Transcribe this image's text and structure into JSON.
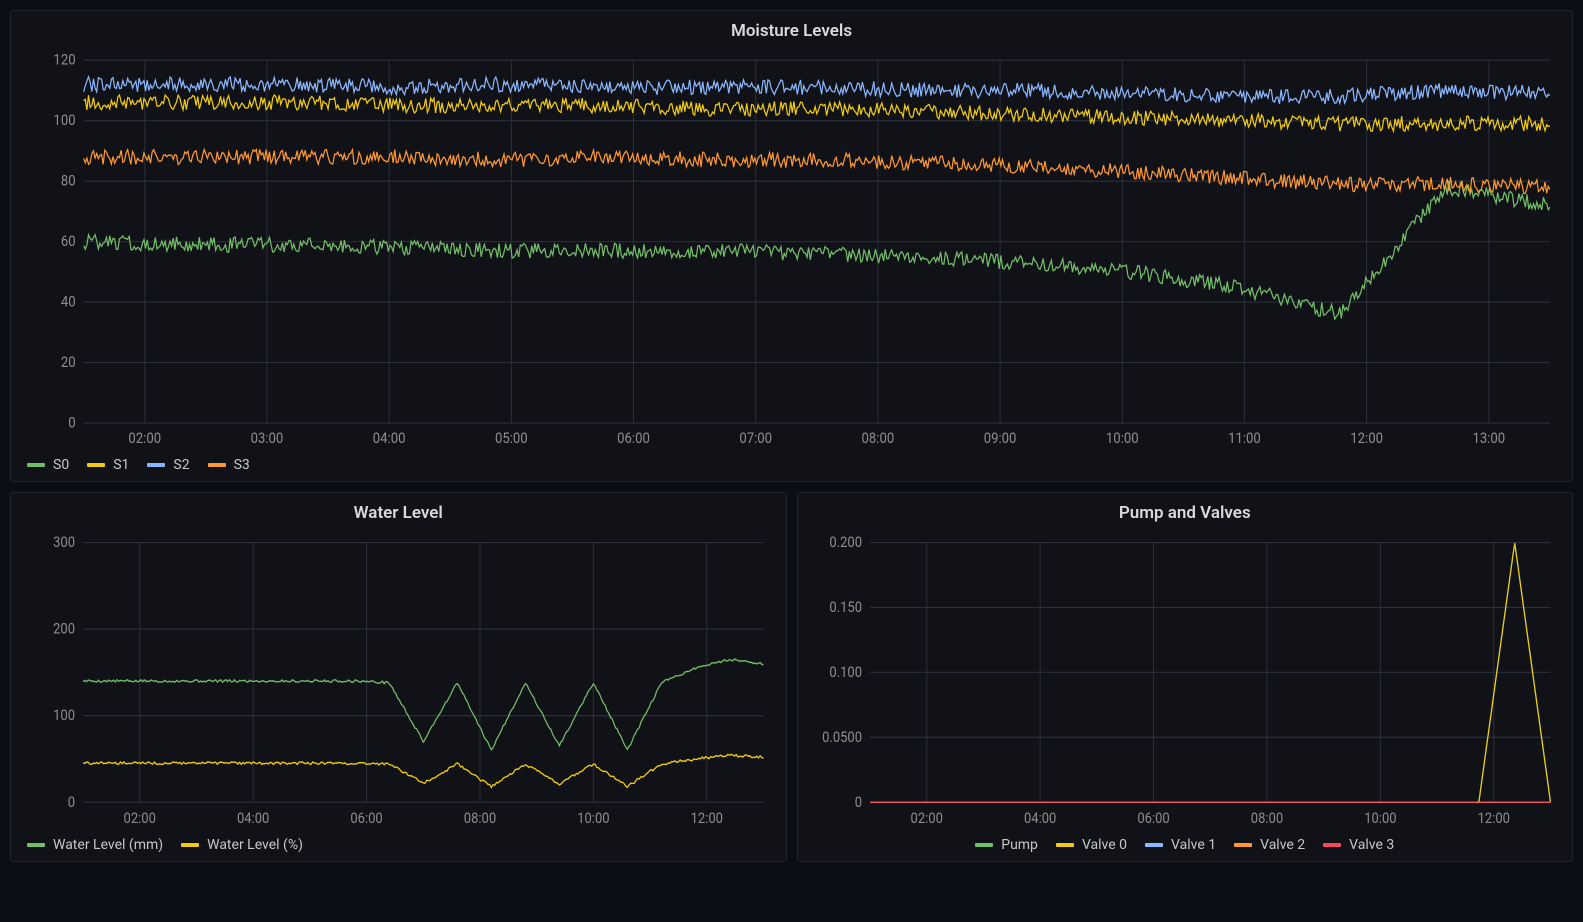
{
  "colors": {
    "green": "#73bf69",
    "yellow": "#f2cc0c",
    "blue": "#8ab8ff",
    "orange": "#ff9830",
    "red": "#f2495c"
  },
  "chart_data": [
    {
      "id": "moisture",
      "type": "line",
      "title": "Moisture Levels",
      "xlabel": "",
      "ylabel": "",
      "ylim": [
        0,
        120
      ],
      "yticks": [
        0,
        20,
        40,
        60,
        80,
        100,
        120
      ],
      "x_categories": [
        "02:00",
        "03:00",
        "04:00",
        "05:00",
        "06:00",
        "07:00",
        "08:00",
        "09:00",
        "10:00",
        "11:00",
        "12:00",
        "13:00"
      ],
      "series": [
        {
          "name": "S0",
          "color": "green",
          "values": [
            60,
            59,
            59,
            58,
            57,
            57,
            57,
            56,
            55,
            53,
            50,
            45,
            36,
            78,
            72
          ]
        },
        {
          "name": "S1",
          "color": "yellow",
          "values": [
            106,
            106,
            106,
            105,
            105,
            105,
            104,
            104,
            103,
            102,
            101,
            100,
            99,
            99,
            99
          ]
        },
        {
          "name": "S2",
          "color": "blue",
          "values": [
            112,
            112,
            112,
            111,
            112,
            111,
            111,
            111,
            110,
            110,
            109,
            108,
            108,
            110,
            109
          ]
        },
        {
          "name": "S3",
          "color": "orange",
          "values": [
            88,
            88,
            88,
            88,
            87,
            88,
            87,
            87,
            86,
            85,
            83,
            81,
            79,
            79,
            78
          ]
        }
      ]
    },
    {
      "id": "water",
      "type": "line",
      "title": "Water Level",
      "xlabel": "",
      "ylabel": "",
      "ylim": [
        0,
        300
      ],
      "yticks": [
        0,
        100,
        200,
        300
      ],
      "x_categories": [
        "02:00",
        "04:00",
        "06:00",
        "08:00",
        "10:00",
        "12:00"
      ],
      "series": [
        {
          "name": "Water Level (mm)",
          "color": "green",
          "values": [
            140,
            140,
            140,
            140,
            140,
            140,
            140,
            140,
            140,
            138,
            70,
            138,
            60,
            138,
            65,
            138,
            60,
            138,
            155,
            165,
            160
          ]
        },
        {
          "name": "Water Level (%)",
          "color": "yellow",
          "values": [
            45,
            45,
            45,
            45,
            45,
            45,
            45,
            45,
            45,
            44,
            22,
            44,
            18,
            44,
            21,
            44,
            18,
            44,
            50,
            54,
            52
          ]
        }
      ]
    },
    {
      "id": "pump",
      "type": "line",
      "title": "Pump and Valves",
      "xlabel": "",
      "ylabel": "",
      "ylim": [
        0,
        0.2
      ],
      "yticks": [
        0,
        0.05,
        0.1,
        0.15,
        0.2
      ],
      "ytick_labels": [
        "0",
        "0.0500",
        "0.100",
        "0.150",
        "0.200"
      ],
      "x_categories": [
        "02:00",
        "04:00",
        "06:00",
        "08:00",
        "10:00",
        "12:00"
      ],
      "series": [
        {
          "name": "Pump",
          "color": "green",
          "values": [
            0,
            0,
            0,
            0,
            0,
            0,
            0,
            0,
            0,
            0,
            0,
            0,
            0,
            0,
            0,
            0,
            0,
            0,
            0.2,
            0
          ]
        },
        {
          "name": "Valve 0",
          "color": "yellow",
          "values": [
            0,
            0,
            0,
            0,
            0,
            0,
            0,
            0,
            0,
            0,
            0,
            0,
            0,
            0,
            0,
            0,
            0,
            0,
            0.2,
            0
          ]
        },
        {
          "name": "Valve 1",
          "color": "blue",
          "values": [
            0,
            0,
            0,
            0,
            0,
            0,
            0,
            0,
            0,
            0,
            0,
            0,
            0,
            0,
            0,
            0,
            0,
            0,
            0,
            0
          ]
        },
        {
          "name": "Valve 2",
          "color": "orange",
          "values": [
            0,
            0,
            0,
            0,
            0,
            0,
            0,
            0,
            0,
            0,
            0,
            0,
            0,
            0,
            0,
            0,
            0,
            0,
            0,
            0
          ]
        },
        {
          "name": "Valve 3",
          "color": "red",
          "values": [
            0,
            0,
            0,
            0,
            0,
            0,
            0,
            0,
            0,
            0,
            0,
            0,
            0,
            0,
            0,
            0,
            0,
            0,
            0,
            0
          ]
        }
      ]
    }
  ]
}
